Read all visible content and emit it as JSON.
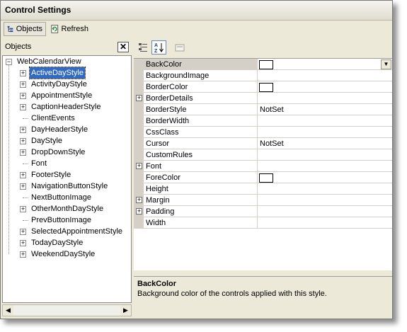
{
  "window": {
    "title": "Control Settings"
  },
  "toolbar": {
    "objects_label": "Objects",
    "refresh_label": "Refresh"
  },
  "objects_panel": {
    "label": "Objects",
    "close_glyph": "✕"
  },
  "tree": {
    "root": "WebCalendarView",
    "items": [
      {
        "label": "ActiveDayStyle",
        "expandable": true,
        "selected": true
      },
      {
        "label": "ActivityDayStyle",
        "expandable": true
      },
      {
        "label": "AppointmentStyle",
        "expandable": true
      },
      {
        "label": "CaptionHeaderStyle",
        "expandable": true
      },
      {
        "label": "ClientEvents",
        "expandable": false
      },
      {
        "label": "DayHeaderStyle",
        "expandable": true
      },
      {
        "label": "DayStyle",
        "expandable": true
      },
      {
        "label": "DropDownStyle",
        "expandable": true
      },
      {
        "label": "Font",
        "expandable": false
      },
      {
        "label": "FooterStyle",
        "expandable": true
      },
      {
        "label": "NavigationButtonStyle",
        "expandable": true
      },
      {
        "label": "NextButtonImage",
        "expandable": false
      },
      {
        "label": "OtherMonthDayStyle",
        "expandable": true
      },
      {
        "label": "PrevButtonImage",
        "expandable": false
      },
      {
        "label": "SelectedAppointmentStyle",
        "expandable": true
      },
      {
        "label": "TodayDayStyle",
        "expandable": true
      },
      {
        "label": "WeekendDayStyle",
        "expandable": true
      }
    ]
  },
  "properties": [
    {
      "name": "BackColor",
      "value": "",
      "swatch": true,
      "expandable": false,
      "selected": true
    },
    {
      "name": "BackgroundImage",
      "value": "",
      "swatch": false,
      "expandable": false
    },
    {
      "name": "BorderColor",
      "value": "",
      "swatch": true,
      "expandable": false
    },
    {
      "name": "BorderDetails",
      "value": "",
      "swatch": false,
      "expandable": true
    },
    {
      "name": "BorderStyle",
      "value": "NotSet",
      "swatch": false,
      "expandable": false
    },
    {
      "name": "BorderWidth",
      "value": "",
      "swatch": false,
      "expandable": false
    },
    {
      "name": "CssClass",
      "value": "",
      "swatch": false,
      "expandable": false
    },
    {
      "name": "Cursor",
      "value": "NotSet",
      "swatch": false,
      "expandable": false
    },
    {
      "name": "CustomRules",
      "value": "",
      "swatch": false,
      "expandable": false
    },
    {
      "name": "Font",
      "value": "",
      "swatch": false,
      "expandable": true
    },
    {
      "name": "ForeColor",
      "value": "",
      "swatch": true,
      "expandable": false
    },
    {
      "name": "Height",
      "value": "",
      "swatch": false,
      "expandable": false
    },
    {
      "name": "Margin",
      "value": "",
      "swatch": false,
      "expandable": true
    },
    {
      "name": "Padding",
      "value": "",
      "swatch": false,
      "expandable": true
    },
    {
      "name": "Width",
      "value": "",
      "swatch": false,
      "expandable": false
    }
  ],
  "description": {
    "title": "BackColor",
    "text": "Background color of the controls applied with this style."
  },
  "colors": {
    "selection": "#316ac5",
    "chrome": "#ece9d8",
    "grid_line": "#d4d0c8"
  }
}
